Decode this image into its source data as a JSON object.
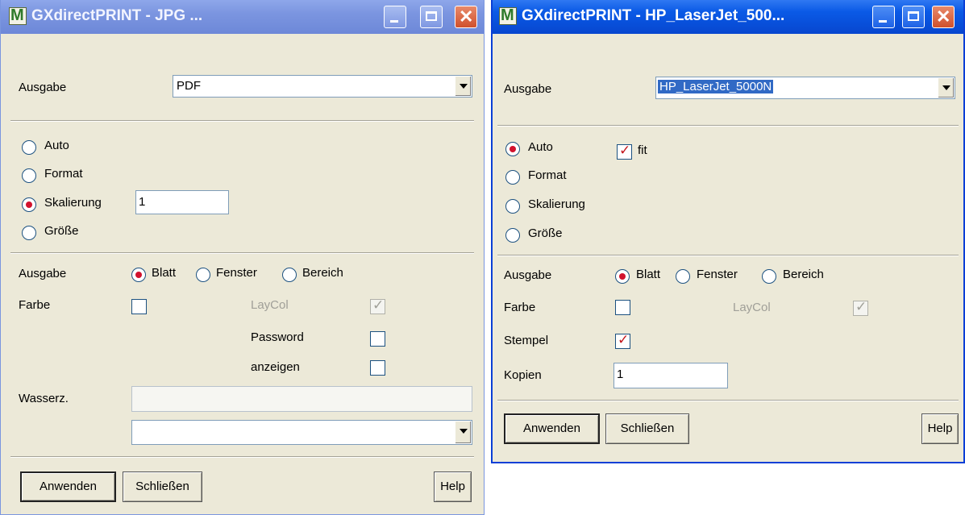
{
  "window1": {
    "title": "GXdirectPRINT - JPG ...",
    "ausgabe_label": "Ausgabe",
    "ausgabe_value": "PDF",
    "radios": {
      "auto": "Auto",
      "format": "Format",
      "skalierung": "Skalierung",
      "groesse": "Größe"
    },
    "scale_value": "1",
    "output_label": "Ausgabe",
    "output_options": {
      "blatt": "Blatt",
      "fenster": "Fenster",
      "bereich": "Bereich"
    },
    "farbe_label": "Farbe",
    "laycol_label": "LayCol",
    "password_label": "Password",
    "anzeigen_label": "anzeigen",
    "wasserz_label": "Wasserz.",
    "buttons": {
      "apply": "Anwenden",
      "close": "Schließen",
      "help": "Help"
    }
  },
  "window2": {
    "title": "GXdirectPRINT - HP_LaserJet_500...",
    "ausgabe_label": "Ausgabe",
    "ausgabe_value": "HP_LaserJet_5000N",
    "radios": {
      "auto": "Auto",
      "format": "Format",
      "skalierung": "Skalierung",
      "groesse": "Größe"
    },
    "fit_label": "fit",
    "output_label": "Ausgabe",
    "output_options": {
      "blatt": "Blatt",
      "fenster": "Fenster",
      "bereich": "Bereich"
    },
    "farbe_label": "Farbe",
    "laycol_label": "LayCol",
    "stempel_label": "Stempel",
    "kopien_label": "Kopien",
    "kopien_value": "1",
    "buttons": {
      "apply": "Anwenden",
      "close": "Schließen",
      "help": "Help"
    }
  },
  "colors": {
    "title_active": "#0a5ae6",
    "title_inactive": "#7b95e0",
    "dialog_bg": "#ece9d8",
    "radio_dot": "#d2122d"
  }
}
